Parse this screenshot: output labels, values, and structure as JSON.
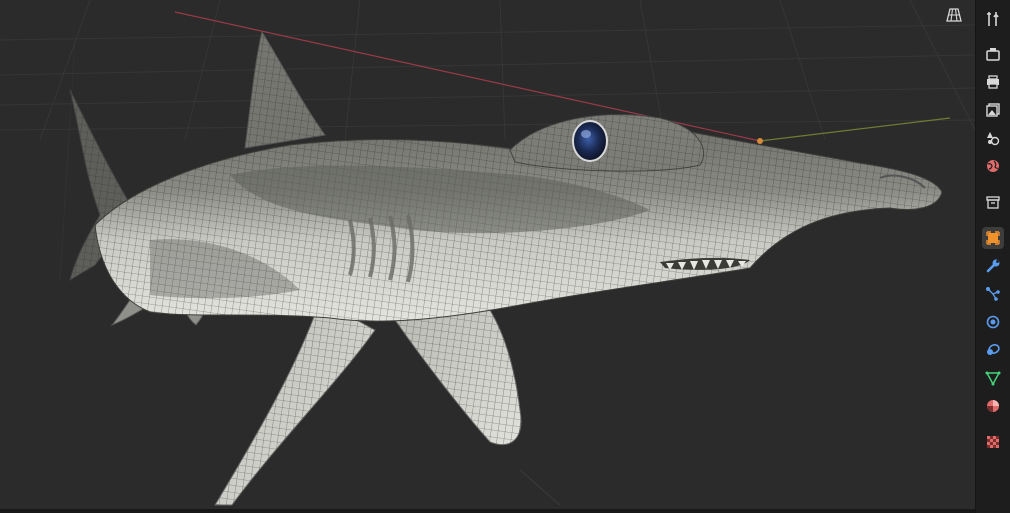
{
  "viewport": {
    "background": "#2b2b2b",
    "object": "hammerhead-shark-mesh",
    "shading": "wireframe-overlay",
    "grid_color": "#3a3a3a",
    "x_axis_color": "#9a3a48",
    "y_axis_color": "#6f7d32",
    "origin_color": "#d68a3a"
  },
  "viewport_header": {
    "toggle_icon": "grid-perspective-icon"
  },
  "properties_tabs": [
    {
      "name": "tool",
      "icon": "tools-icon",
      "color": "#d8d8d8"
    },
    {
      "name": "render",
      "icon": "camera-back-icon",
      "color": "#d8d8d8"
    },
    {
      "name": "output",
      "icon": "printer-icon",
      "color": "#d8d8d8"
    },
    {
      "name": "view-layer",
      "icon": "images-icon",
      "color": "#d8d8d8"
    },
    {
      "name": "scene",
      "icon": "scene-icon",
      "color": "#d8d8d8"
    },
    {
      "name": "world",
      "icon": "globe-icon",
      "color": "#e06b6b"
    },
    {
      "name": "collection",
      "icon": "box-icon",
      "color": "#d8d8d8"
    },
    {
      "name": "object",
      "icon": "square-object-icon",
      "color": "#f0922b",
      "active": true
    },
    {
      "name": "modifiers",
      "icon": "wrench-icon",
      "color": "#5a9cef"
    },
    {
      "name": "particles",
      "icon": "particles-icon",
      "color": "#5a9cef"
    },
    {
      "name": "physics",
      "icon": "physics-icon",
      "color": "#5a9cef"
    },
    {
      "name": "constraints",
      "icon": "constraint-icon",
      "color": "#5a9cef"
    },
    {
      "name": "data",
      "icon": "mesh-data-icon",
      "color": "#44d47a"
    },
    {
      "name": "material",
      "icon": "material-icon",
      "color": "#e06b6b"
    },
    {
      "name": "texture",
      "icon": "checker-texture-icon",
      "color": "#e06b6b"
    }
  ]
}
